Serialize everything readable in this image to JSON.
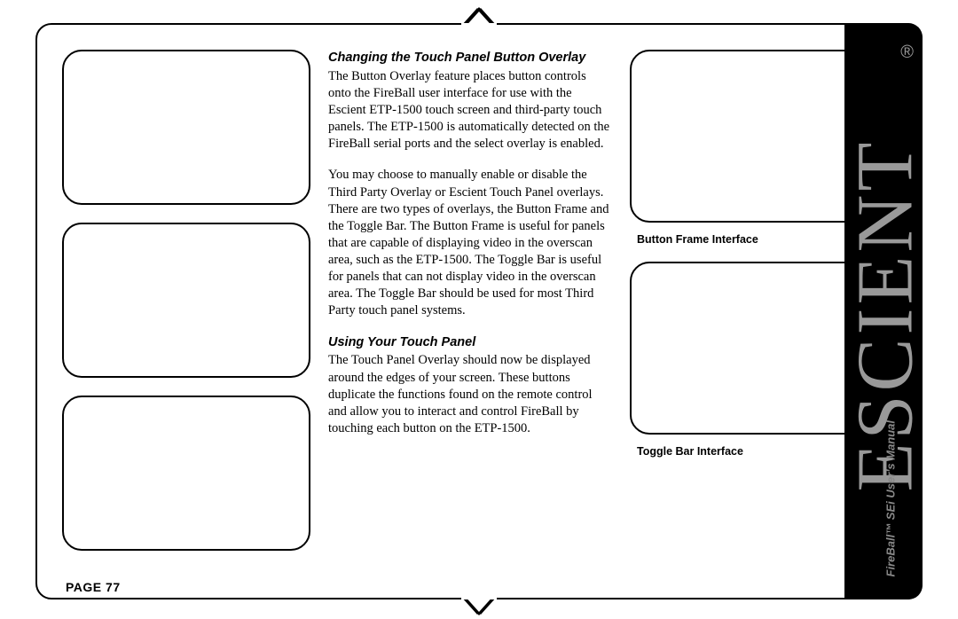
{
  "page_label": "PAGE 77",
  "brand": {
    "name": "ESCIENT",
    "registered": "®",
    "subtitle_product": "FireBall™",
    "subtitle_model": "SEi",
    "subtitle_rest": "User's Manual"
  },
  "midcol": {
    "heading1": "Changing the Touch Panel Button Overlay",
    "para1": "The Button Overlay feature places button controls onto the FireBall user interface for use with the Escient ETP-1500 touch screen and third-party touch panels. The ETP-1500 is automatically detected on the FireBall serial ports and the select overlay is enabled.",
    "para2": "You may choose to manually enable or disable the Third Party Overlay or Escient Touch Panel overlays. There are two types of overlays, the Button Frame and the Toggle Bar. The Button Frame is useful for panels that are capable of displaying video in the overscan area, such as the ETP-1500. The Toggle Bar is useful for panels that can not display video in the overscan area. The Toggle Bar should be used for most Third Party touch panel systems.",
    "heading2": "Using Your Touch Panel",
    "para3": "The Touch Panel Overlay should now be displayed around the edges of your screen. These buttons duplicate the functions found on the remote control and allow you to interact and control FireBall by touching each button on the ETP-1500."
  },
  "rightcol": {
    "caption1": "Button Frame Interface",
    "caption2": "Toggle Bar Interface"
  }
}
